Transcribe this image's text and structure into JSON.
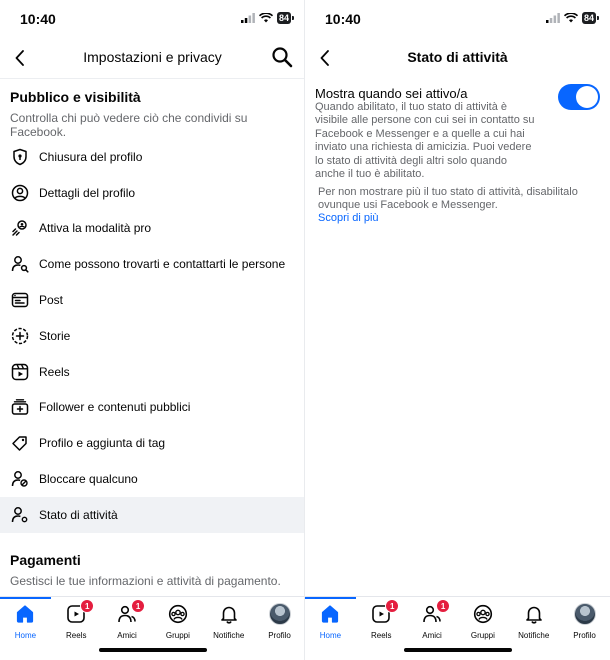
{
  "status": {
    "time": "10:40",
    "battery": "84"
  },
  "left": {
    "header": {
      "title": "Impostazioni e privacy"
    },
    "section1": {
      "title": "Pubblico e visibilità",
      "subtitle": "Controlla chi può vedere ciò che condividi su Facebook."
    },
    "menu": [
      {
        "label": "Chiusura del profilo",
        "icon": "shield-lock-icon"
      },
      {
        "label": "Dettagli del profilo",
        "icon": "user-circle-icon"
      },
      {
        "label": "Attiva la modalità pro",
        "icon": "pro-mode-icon"
      },
      {
        "label": "Come possono trovarti e contattarti le persone",
        "icon": "user-search-icon"
      },
      {
        "label": "Post",
        "icon": "post-icon"
      },
      {
        "label": "Storie",
        "icon": "story-add-icon"
      },
      {
        "label": "Reels",
        "icon": "reels-icon"
      },
      {
        "label": "Follower e contenuti pubblici",
        "icon": "followers-icon"
      },
      {
        "label": "Profilo e aggiunta di tag",
        "icon": "tag-icon"
      },
      {
        "label": "Bloccare qualcuno",
        "icon": "block-user-icon"
      },
      {
        "label": "Stato di attività",
        "icon": "activity-status-icon"
      }
    ],
    "section2": {
      "title": "Pagamenti",
      "subtitle": "Gestisci le tue informazioni e attività di pagamento."
    }
  },
  "right": {
    "header": {
      "title": "Stato di attività"
    },
    "setting": {
      "title": "Mostra quando sei attivo/a",
      "description": "Quando abilitato, il tuo stato di attività è visibile alle persone con cui sei in contatto su Facebook e Messenger e a quelle a cui hai inviato una richiesta di amicizia. Puoi vedere lo stato di attività degli altri solo quando anche il tuo è abilitato.",
      "enabled": true
    },
    "hint": "Per non mostrare più il tuo stato di attività, disabilitalo ovunque usi Facebook e Messenger.",
    "link": "Scopri di più"
  },
  "tabbar": {
    "tabs": [
      {
        "label": "Home",
        "icon": "home-icon",
        "active": true
      },
      {
        "label": "Reels",
        "icon": "reels-icon",
        "badge": "1"
      },
      {
        "label": "Amici",
        "icon": "friends-icon",
        "badge": "1"
      },
      {
        "label": "Gruppi",
        "icon": "groups-icon"
      },
      {
        "label": "Notifiche",
        "icon": "bell-icon"
      },
      {
        "label": "Profilo",
        "icon": "avatar"
      }
    ]
  },
  "colors": {
    "accent": "#0866ff",
    "badge": "#e41e3f",
    "secondary_text": "#65676b"
  }
}
